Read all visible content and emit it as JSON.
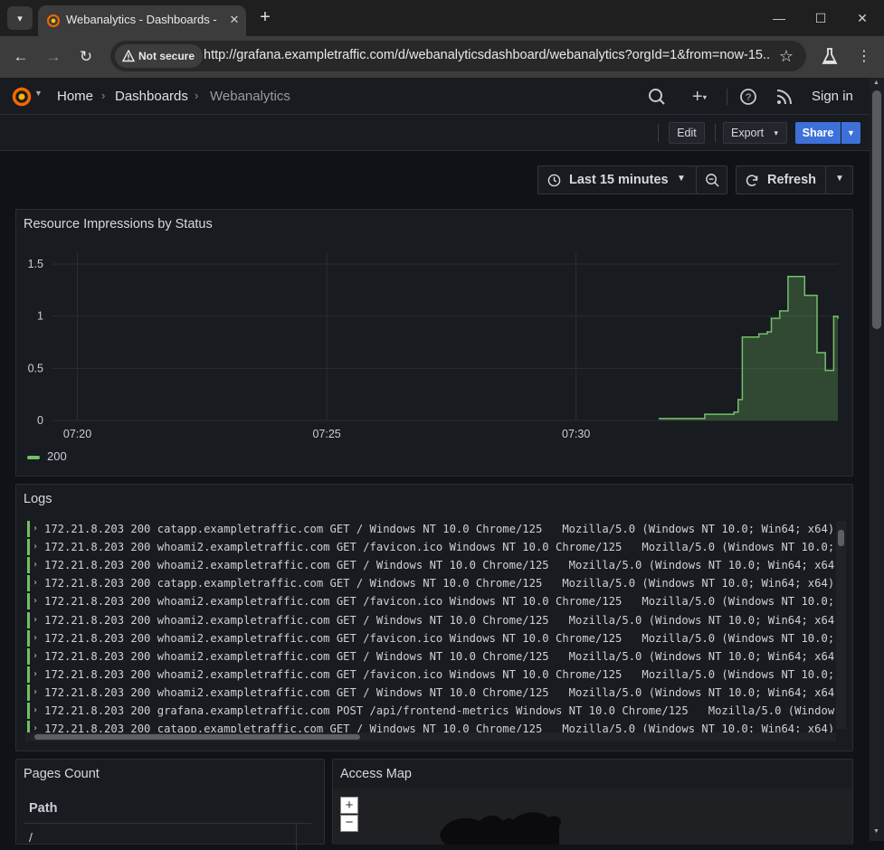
{
  "browser": {
    "tab_title": "Webanalytics - Dashboards - Grafana",
    "security_label": "Not secure",
    "url": "http://grafana.exampletraffic.com/d/webanalyticsdashboard/webanalytics?orgId=1&from=now-15..."
  },
  "nav": {
    "breadcrumbs": [
      "Home",
      "Dashboards",
      "Webanalytics"
    ],
    "sign_in": "Sign in"
  },
  "actions": {
    "edit": "Edit",
    "export": "Export",
    "share": "Share"
  },
  "time": {
    "range": "Last 15 minutes",
    "refresh": "Refresh"
  },
  "panels": {
    "chart_title": "Resource Impressions by Status",
    "logs_title": "Logs",
    "pages_title": "Pages Count",
    "pages_column": "Path",
    "pages_first_row": "/",
    "map_title": "Access Map",
    "map_zoom_in": "+",
    "map_zoom_out": "−"
  },
  "chart_data": {
    "type": "area",
    "title": "Resource Impressions by Status",
    "y_ticks": [
      "0",
      "0.5",
      "1",
      "1.5"
    ],
    "x_ticks": [
      "07:20",
      "07:25",
      "07:30"
    ],
    "ylim": [
      0,
      1.5
    ],
    "grid": true,
    "legend_position": "bottom-left",
    "series": [
      {
        "name": "200",
        "color": "#73bf69",
        "x": [
          "07:31:40",
          "07:32:00",
          "07:32:30",
          "07:32:35",
          "07:32:50",
          "07:33:10",
          "07:33:15",
          "07:33:20",
          "07:33:25",
          "07:33:40",
          "07:33:50",
          "07:33:55",
          "07:34:00",
          "07:34:05",
          "07:34:15",
          "07:34:20",
          "07:34:30",
          "07:34:35",
          "07:34:45",
          "07:34:50",
          "07:34:55",
          "07:35:00",
          "07:35:05",
          "07:35:10",
          "07:35:15"
        ],
        "values": [
          0.02,
          0.02,
          0.02,
          0.06,
          0.06,
          0.08,
          0.2,
          0.8,
          0.8,
          0.83,
          0.85,
          0.98,
          0.98,
          1.05,
          1.38,
          1.38,
          1.38,
          1.2,
          1.2,
          0.65,
          0.65,
          0.48,
          0.48,
          1.0,
          0.98
        ]
      }
    ]
  },
  "logs": [
    "172.21.8.203 200 catapp.exampletraffic.com GET / Windows NT 10.0 Chrome/125   Mozilla/5.0 (Windows NT 10.0; Win64; x64)",
    "172.21.8.203 200 whoami2.exampletraffic.com GET /favicon.ico Windows NT 10.0 Chrome/125   Mozilla/5.0 (Windows NT 10.0;",
    "172.21.8.203 200 whoami2.exampletraffic.com GET / Windows NT 10.0 Chrome/125   Mozilla/5.0 (Windows NT 10.0; Win64; x64",
    "172.21.8.203 200 catapp.exampletraffic.com GET / Windows NT 10.0 Chrome/125   Mozilla/5.0 (Windows NT 10.0; Win64; x64)",
    "172.21.8.203 200 whoami2.exampletraffic.com GET /favicon.ico Windows NT 10.0 Chrome/125   Mozilla/5.0 (Windows NT 10.0;",
    "172.21.8.203 200 whoami2.exampletraffic.com GET / Windows NT 10.0 Chrome/125   Mozilla/5.0 (Windows NT 10.0; Win64; x64",
    "172.21.8.203 200 whoami2.exampletraffic.com GET /favicon.ico Windows NT 10.0 Chrome/125   Mozilla/5.0 (Windows NT 10.0;",
    "172.21.8.203 200 whoami2.exampletraffic.com GET / Windows NT 10.0 Chrome/125   Mozilla/5.0 (Windows NT 10.0; Win64; x64",
    "172.21.8.203 200 whoami2.exampletraffic.com GET /favicon.ico Windows NT 10.0 Chrome/125   Mozilla/5.0 (Windows NT 10.0;",
    "172.21.8.203 200 whoami2.exampletraffic.com GET / Windows NT 10.0 Chrome/125   Mozilla/5.0 (Windows NT 10.0; Win64; x64",
    "172.21.8.203 200 grafana.exampletraffic.com POST /api/frontend-metrics Windows NT 10.0 Chrome/125   Mozilla/5.0 (Window",
    "172.21.8.203 200 catapp.exampletraffic.com GET / Windows NT 10.0 Chrome/125   Mozilla/5.0 (Windows NT 10.0; Win64; x64)"
  ]
}
